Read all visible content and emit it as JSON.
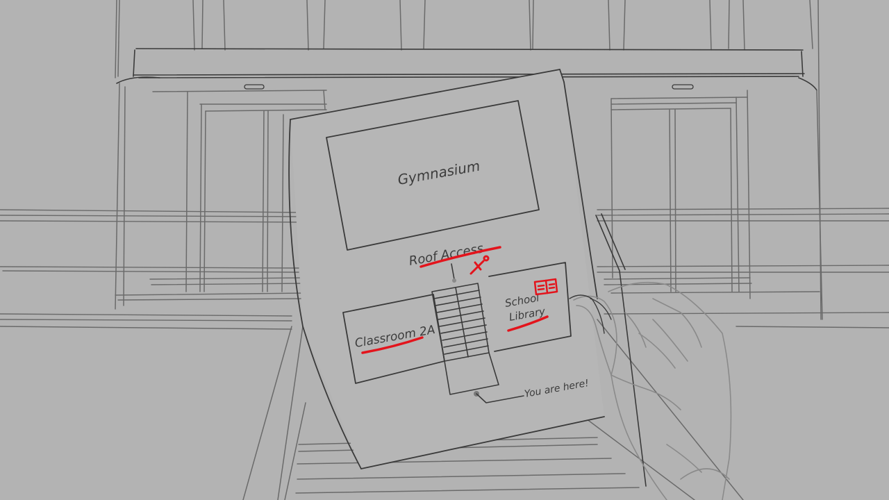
{
  "map": {
    "gymnasium_label": "Gymnasium",
    "roof_access_label": "Roof Access",
    "classroom_label": "Classroom 2A",
    "library_label_line1": "School",
    "library_label_line2": "Library",
    "you_are_here_label": "You are here!"
  },
  "colors": {
    "background": "#b3b3b3",
    "ink": "#3a3a3a",
    "marker_red": "#e3141c"
  },
  "icons": {
    "roof_access_marker": "sword-icon",
    "library_marker": "open-book-icon",
    "current_location_marker": "location-dot-icon"
  }
}
